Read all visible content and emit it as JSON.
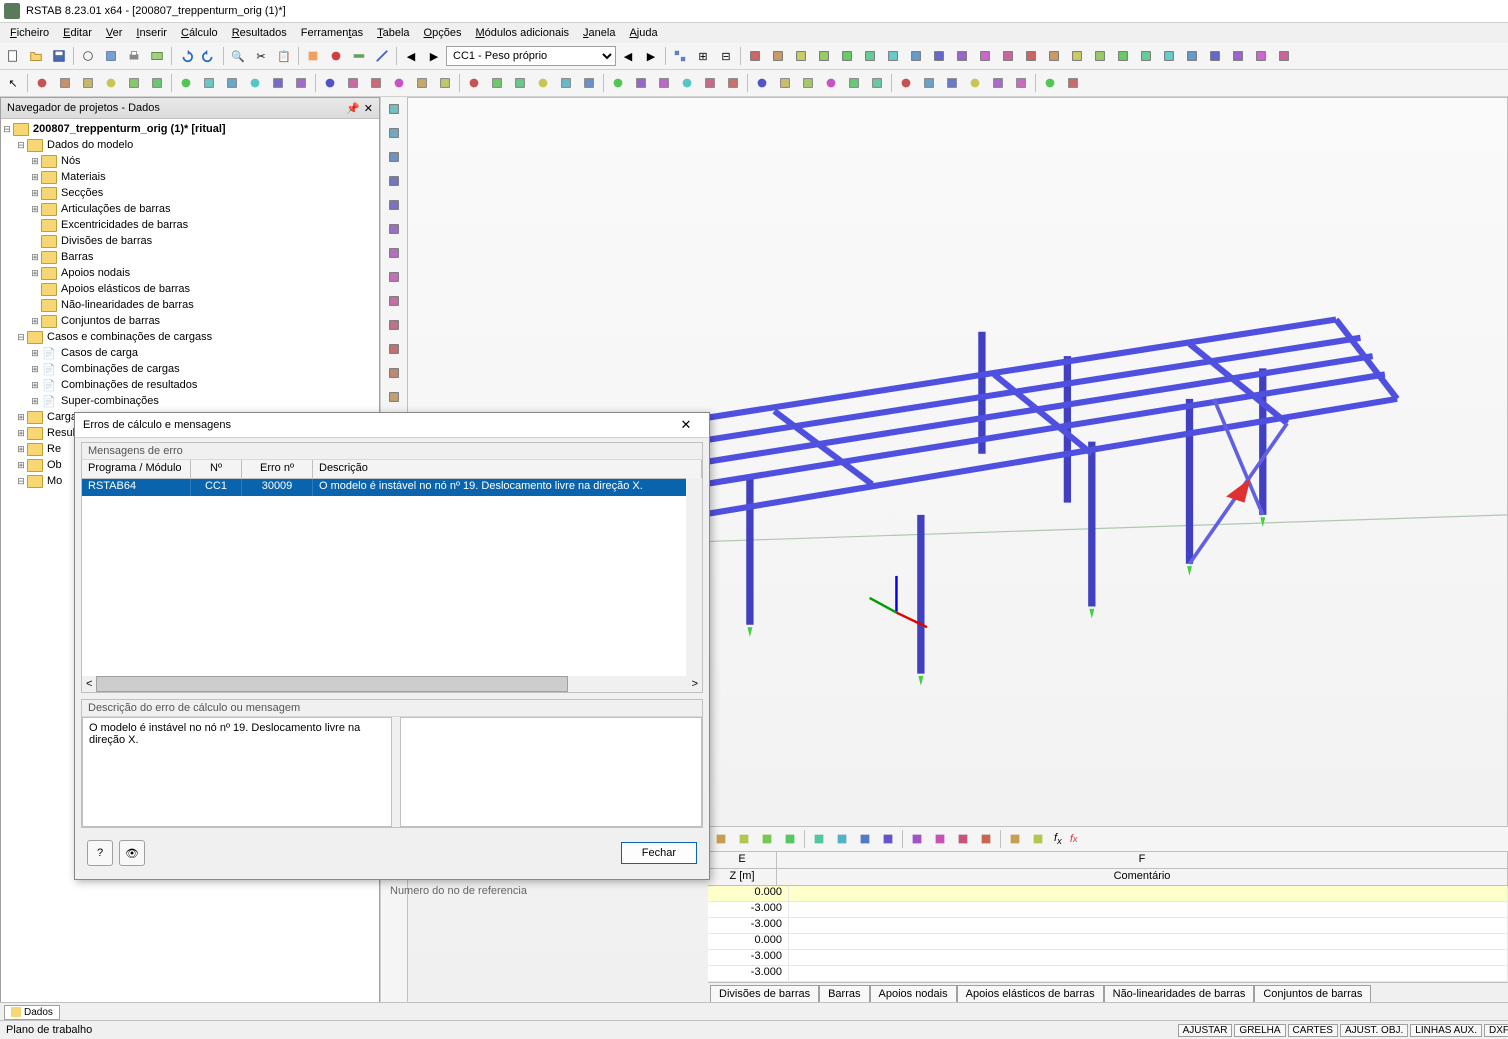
{
  "title": "RSTAB 8.23.01 x64 - [200807_treppenturm_orig (1)*]",
  "menu": {
    "file": "Ficheiro",
    "edit": "Editar",
    "view": "Ver",
    "insert": "Inserir",
    "calc": "Cálculo",
    "results": "Resultados",
    "tools": "Ferramentas",
    "table": "Tabela",
    "options": "Opções",
    "addon": "Módulos adicionais",
    "window": "Janela",
    "help": "Ajuda"
  },
  "loadcase": "CC1 - Peso próprio",
  "navigator": {
    "title": "Navegador de projetos - Dados",
    "root": "200807_treppenturm_orig (1)* [ritual]",
    "model_data": "Dados do modelo",
    "items": {
      "nodes": "Nós",
      "materials": "Materiais",
      "sections": "Secções",
      "hinges": "Articulações de barras",
      "eccentric": "Excentricidades de barras",
      "divisions": "Divisões de barras",
      "members": "Barras",
      "supports": "Apoios nodais",
      "elastic": "Apoios elásticos de barras",
      "nonlin": "Não-linearidades de barras",
      "sets": "Conjuntos de barras"
    },
    "load_cases": "Casos e combinações de cargass",
    "lc_items": {
      "lc": "Casos de carga",
      "co": "Combinações de cargas",
      "rc": "Combinações de resultados",
      "sc": "Super-combinações"
    },
    "loads": "Cargas",
    "results": "Resultados",
    "re": "Re",
    "ob": "Ob",
    "mo": "Mo"
  },
  "dialog": {
    "title": "Erros de cálculo e mensagens",
    "group1": "Mensagens de erro",
    "headers": {
      "prog": "Programa / Módulo",
      "no": "Nº",
      "errno": "Erro nº",
      "desc": "Descrição"
    },
    "row": {
      "prog": "RSTAB64",
      "no": "CC1",
      "errno": "30009",
      "desc": "O modelo é instável no nó nº 19. Deslocamento livre na direção X."
    },
    "group2": "Descrição do erro de cálculo ou mensagem",
    "detail": "O modelo é instável no nó nº 19. Deslocamento livre na direção X.",
    "close": "Fechar"
  },
  "table": {
    "col_e": "E",
    "col_f": "F",
    "z_label": "Z [m]",
    "comment": "Comentário",
    "rows": [
      "0.000",
      "-3.000",
      "-3.000",
      "0.000",
      "-3.000",
      "-3.000"
    ]
  },
  "bottom_tabs": [
    "Divisões de barras",
    "Barras",
    "Apoios nodais",
    "Apoios elásticos de barras",
    "Não-linearidades de barras",
    "Conjuntos de barras"
  ],
  "left_tab": "Dados",
  "hidden_msg": "Numero do no de referencia",
  "status": {
    "left": "Plano de trabalho",
    "segs": [
      "AJUSTAR",
      "GRELHA",
      "CARTES",
      "AJUST. OBJ.",
      "LINHAS AUX.",
      "DXF"
    ]
  }
}
